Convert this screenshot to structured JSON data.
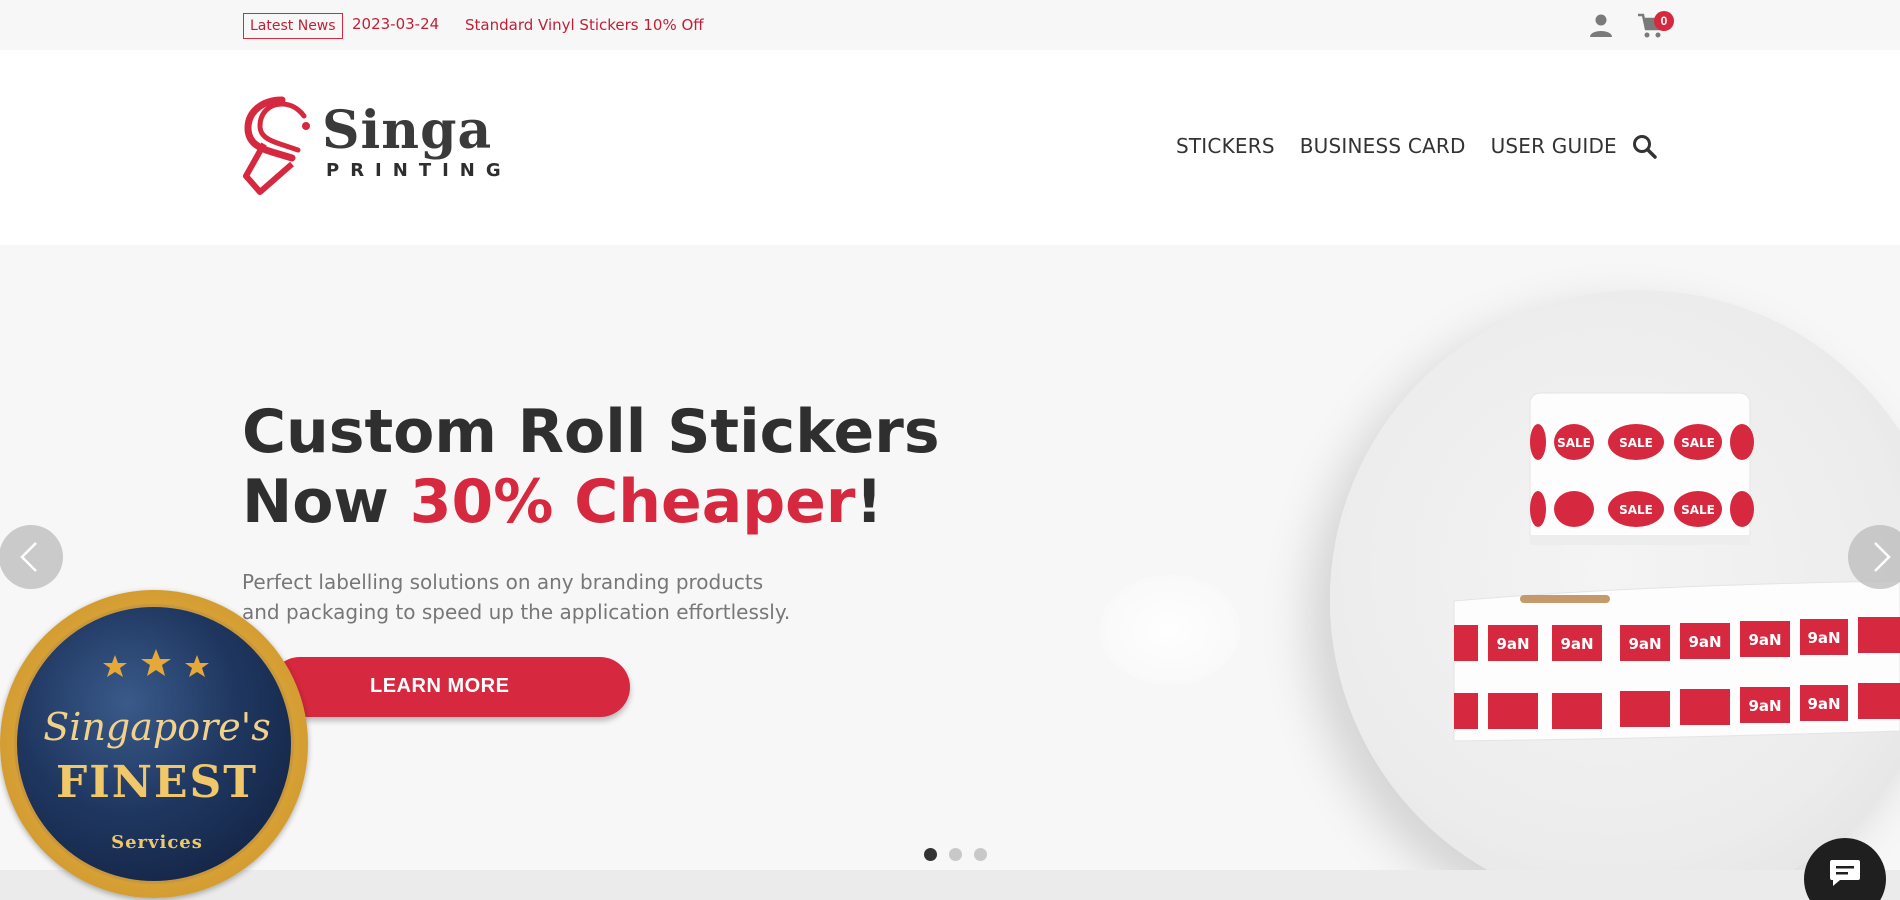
{
  "topbar": {
    "news_tag": "Latest News",
    "news_date": "2023-03-24",
    "news_title": "Standard Vinyl Stickers 10% Off",
    "cart_count": "0",
    "icons": [
      "user-icon",
      "cart-icon"
    ]
  },
  "header": {
    "logo_word": "Singa",
    "logo_sub": "PRINTING",
    "nav": [
      "STICKERS",
      "BUSINESS CARD",
      "USER GUIDE"
    ],
    "search_icon": "search-icon"
  },
  "hero": {
    "title_line1": "Custom Roll Stickers",
    "title_line2_prefix": "Now ",
    "title_line2_accent": "30% Cheaper",
    "title_line2_suffix": "!",
    "description": "Perfect labelling solutions on any branding products and packaging to speed up the application effortlessly.",
    "cta_label": "LEARN MORE",
    "slides": 3,
    "active_slide": 1,
    "accent_color": "#d6283f"
  },
  "product_art": {
    "labels_top": [
      "SALE",
      "SALE",
      "SALE",
      "SALE",
      "SALE"
    ],
    "labels_bottom": [
      "9aN",
      "9aN",
      "9aN",
      "9aN",
      "9aN",
      "9aN",
      "9aN",
      "9aN"
    ]
  },
  "badge": {
    "script": "Singapore's",
    "finest": "FINEST",
    "services": "Services"
  }
}
